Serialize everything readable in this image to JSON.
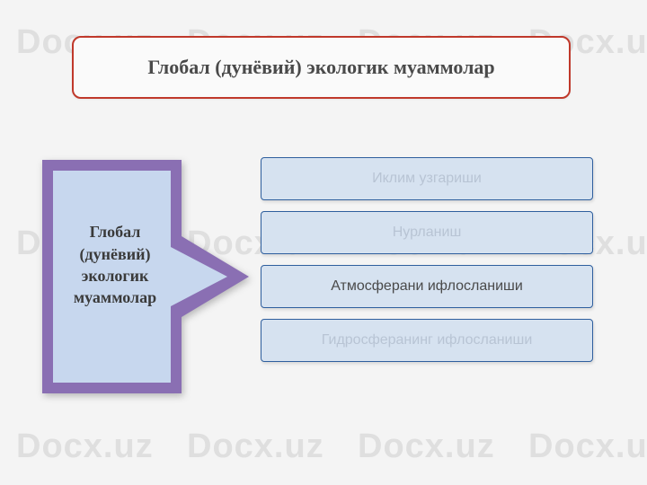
{
  "watermark": "Docx.uz",
  "title": "Глобал (дунёвий) экологик муаммолар",
  "arrow_label": "Глобал (дунёвий) экологик муаммолар",
  "items": [
    {
      "label": "Иклим узгариши",
      "light": true
    },
    {
      "label": "Нурланиш",
      "light": true
    },
    {
      "label": "Атмосферани ифлосланиши",
      "light": false
    },
    {
      "label": "Гидросферанинг ифлосланиши",
      "light": true
    }
  ],
  "colors": {
    "title_border": "#c0392b",
    "arrow_border": "#8a6fb3",
    "arrow_fill": "#c7d7ee",
    "item_fill": "#d6e2f0",
    "item_border": "#2f5f9e"
  }
}
